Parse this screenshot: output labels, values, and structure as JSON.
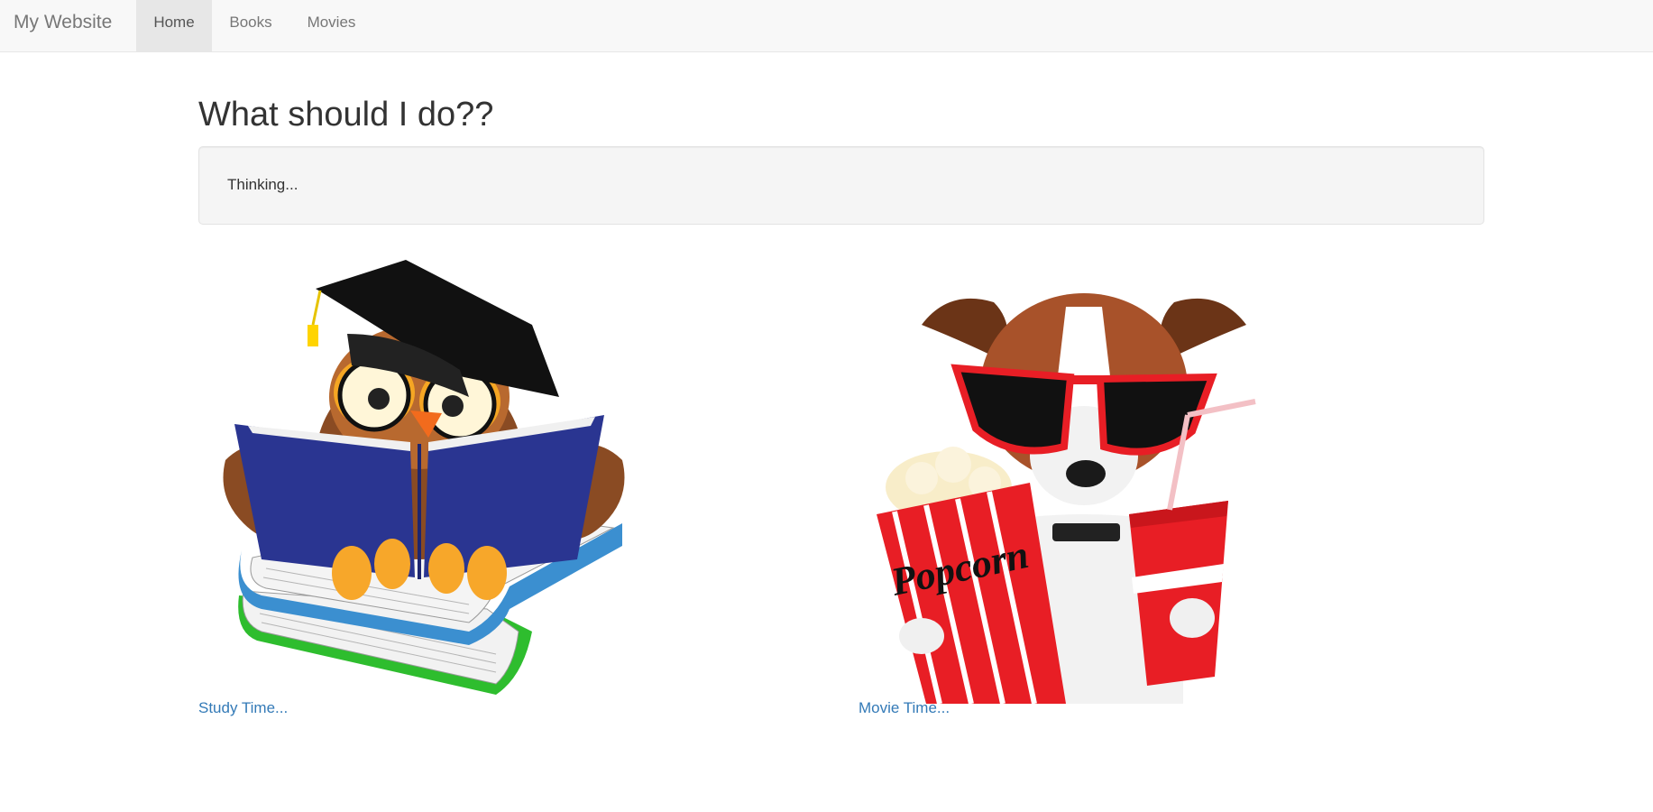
{
  "navbar": {
    "brand": "My Website",
    "items": [
      {
        "label": "Home",
        "active": true
      },
      {
        "label": "Books",
        "active": false
      },
      {
        "label": "Movies",
        "active": false
      }
    ]
  },
  "main": {
    "title": "What should I do??",
    "status_text": "Thinking..."
  },
  "tiles": [
    {
      "image": "owl-reading-books-illustration",
      "link_label": "Study Time..."
    },
    {
      "image": "dog-with-popcorn-and-soda-illustration",
      "link_label": "Movie Time..."
    }
  ],
  "colors": {
    "link": "#337ab7",
    "navbar_bg": "#f8f8f8",
    "active_tab_bg": "#e7e7e7",
    "well_bg": "#f5f5f5"
  }
}
